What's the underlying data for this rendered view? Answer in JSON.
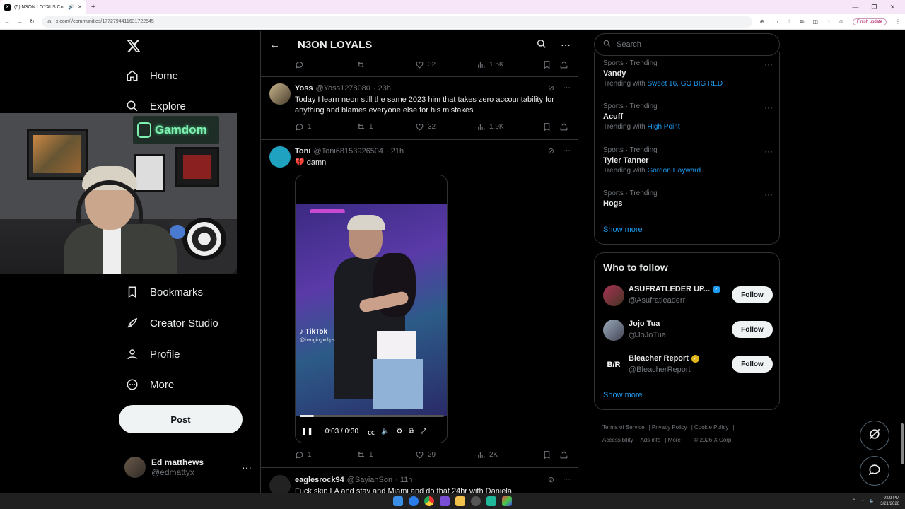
{
  "browser": {
    "tab_title": "(5) N3ON LOYALS Communi",
    "new_tab": "+",
    "url": "x.com/i/communities/1772794411631722545",
    "finish_update": "Finish update"
  },
  "nav": {
    "home": "Home",
    "explore": "Explore",
    "bookmarks": "Bookmarks",
    "creator_studio": "Creator Studio",
    "profile": "Profile",
    "more": "More",
    "post": "Post"
  },
  "account": {
    "name": "Ed matthews",
    "handle": "@edmattyx"
  },
  "webcam": {
    "sign_text": "Gamdom"
  },
  "center": {
    "title": "N3ON LOYALS",
    "top_actions": {
      "replies": "",
      "retweets": "",
      "likes": "32",
      "views": "1.5K"
    },
    "tweets": [
      {
        "name": "Yoss",
        "handle": "@Yoss1278080",
        "time": "· 23h",
        "text": "Today I learn neon still the same 2023 him that takes zero accountability for anything and blames everyone else for his mistakes",
        "replies": "1",
        "retweets": "1",
        "likes": "32",
        "views": "1.9K"
      },
      {
        "name": "Toni",
        "handle": "@Toni68153926504",
        "time": "· 21h",
        "text": "💔 damn",
        "replies": "1",
        "retweets": "1",
        "likes": "29",
        "views": "2K",
        "video": {
          "watermark": "TikTok",
          "watermark_handle": "@bangingxclips",
          "time": "0:03 / 0:30",
          "progress": 0.1
        }
      },
      {
        "name": "eaglesrock94",
        "handle": "@SayianSon",
        "time": "· 11h",
        "text": "Fuck skip LA and stay and Miami and do that 24hr with Daniela"
      }
    ]
  },
  "right": {
    "search_placeholder": "Search",
    "trends": [
      {
        "meta": "Sports · Trending",
        "topic": "Vandy",
        "with_label": "Trending with",
        "with_link": "Sweet 16, GO BIG RED"
      },
      {
        "meta": "Sports · Trending",
        "topic": "Acuff",
        "with_label": "Trending with",
        "with_link": "High Point"
      },
      {
        "meta": "Sports · Trending",
        "topic": "Tyler Tanner",
        "with_label": "Trending with",
        "with_link": "Gordon Hayward"
      },
      {
        "meta": "Sports · Trending",
        "topic": "Hogs",
        "with_label": "",
        "with_link": ""
      }
    ],
    "show_more": "Show more",
    "who_to_follow": "Who to follow",
    "people": [
      {
        "name": "ASUFRATLEDER UP...",
        "handle": "@Asufratleaderr",
        "follow": "Follow",
        "badge_color": "#1d9bf0"
      },
      {
        "name": "Jojo Tua",
        "handle": "@JoJoTua",
        "follow": "Follow",
        "badge_color": ""
      },
      {
        "name": "Bleacher Report",
        "handle": "@BleacherReport",
        "follow": "Follow",
        "badge_color": "#e2b719",
        "avatar_text": "B/R"
      }
    ],
    "show_more_2": "Show more",
    "footer": {
      "terms": "Terms of Service",
      "privacy": "Privacy Policy",
      "cookie": "Cookie Policy",
      "accessibility": "Accessibility",
      "ads": "Ads info",
      "more": "More ···",
      "copyright": "© 2026 X Corp."
    }
  },
  "taskbar": {
    "time": "9:09 PM",
    "date": "3/21/2026"
  },
  "colors": {
    "accent": "#1d9bf0",
    "background": "#000000",
    "text": "#e7e9ea",
    "muted": "#71767b",
    "border": "#2f3336"
  }
}
